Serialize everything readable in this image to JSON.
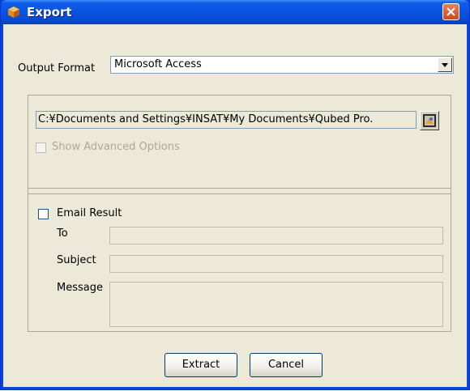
{
  "window": {
    "title": "Export",
    "close_icon": "close-icon"
  },
  "output_format": {
    "label": "Output Format",
    "selected": "Microsoft Access"
  },
  "file": {
    "path": "C:¥Documents and Settings¥INSAT¥My Documents¥Qubed Pro.",
    "browse_icon": "browse-folder-icon"
  },
  "advanced": {
    "label": "Show Advanced Options",
    "checked": false,
    "enabled": false
  },
  "email": {
    "checkbox_label": "Email Result",
    "checked": false,
    "to_label": "To",
    "to_value": "",
    "subject_label": "Subject",
    "subject_value": "",
    "message_label": "Message",
    "message_value": ""
  },
  "buttons": {
    "extract": "Extract",
    "cancel": "Cancel"
  },
  "colors": {
    "titlebar": "#0a53e0",
    "client_bg": "#ece9d8",
    "close_button": "#d2461c"
  }
}
